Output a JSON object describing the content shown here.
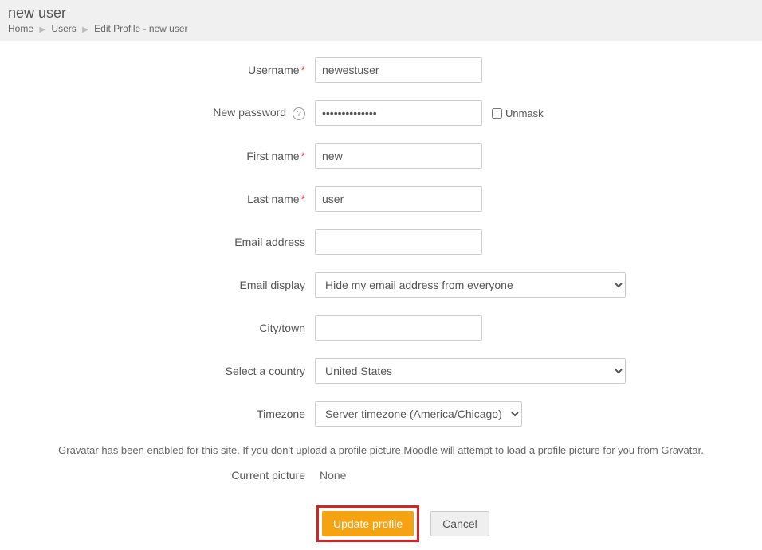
{
  "header": {
    "title": "new user",
    "breadcrumb": {
      "home": "Home",
      "users": "Users",
      "current": "Edit Profile - new user"
    }
  },
  "form": {
    "username": {
      "label": "Username",
      "value": "newestuser"
    },
    "password": {
      "label": "New password",
      "value": "••••••••••••••"
    },
    "unmask": {
      "label": "Unmask"
    },
    "first_name": {
      "label": "First name",
      "value": "new"
    },
    "last_name": {
      "label": "Last name",
      "value": "user"
    },
    "email": {
      "label": "Email address",
      "value": ""
    },
    "email_display": {
      "label": "Email display",
      "value": "Hide my email address from everyone"
    },
    "city": {
      "label": "City/town",
      "value": ""
    },
    "country": {
      "label": "Select a country",
      "value": "United States"
    },
    "timezone": {
      "label": "Timezone",
      "value": "Server timezone (America/Chicago)"
    }
  },
  "gravatar_note": "Gravatar has been enabled for this site. If you don't upload a profile picture Moodle will attempt to load a profile picture for you from Gravatar.",
  "current_picture": {
    "label": "Current picture",
    "value": "None"
  },
  "buttons": {
    "update": "Update profile",
    "cancel": "Cancel"
  }
}
